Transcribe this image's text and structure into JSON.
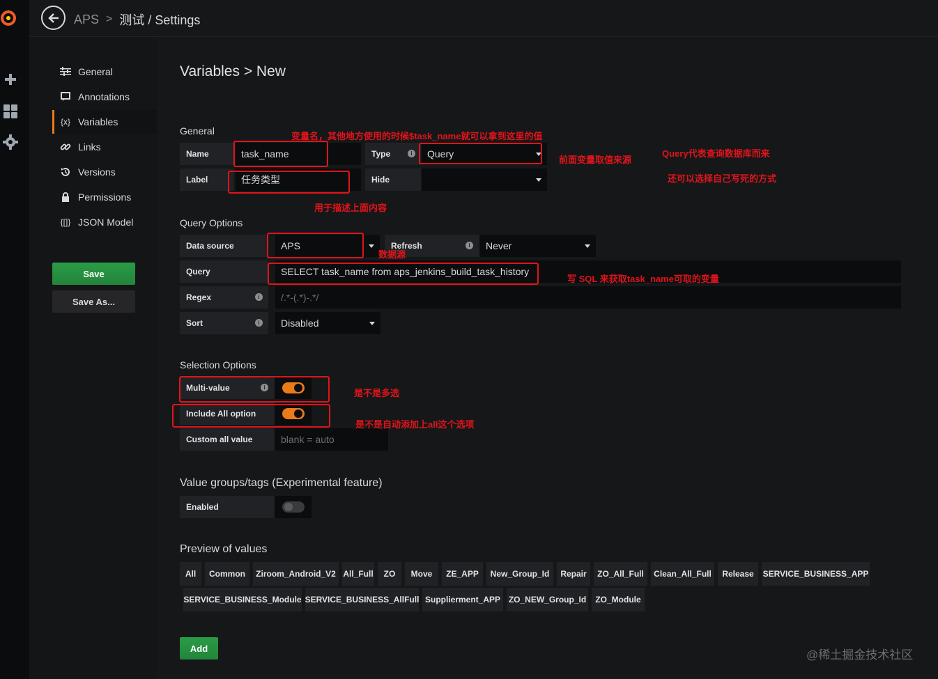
{
  "breadcrumb": {
    "app": "APS",
    "separator": ">",
    "page": "测试 / Settings"
  },
  "sidenav": {
    "items": [
      {
        "label": "General",
        "icon": "sliders-icon"
      },
      {
        "label": "Annotations",
        "icon": "comment-icon"
      },
      {
        "label": "Variables",
        "icon": "variable-icon"
      },
      {
        "label": "Links",
        "icon": "link-icon"
      },
      {
        "label": "Versions",
        "icon": "history-icon"
      },
      {
        "label": "Permissions",
        "icon": "lock-icon"
      },
      {
        "label": "JSON Model",
        "icon": "json-icon"
      }
    ],
    "active": "Variables",
    "save_label": "Save",
    "save_as_label": "Save As..."
  },
  "page_title": "Variables > New",
  "general": {
    "heading": "General",
    "name_label": "Name",
    "name_value": "task_name",
    "type_label": "Type",
    "type_value": "Query",
    "label_label": "Label",
    "label_value": "任务类型",
    "hide_label": "Hide",
    "hide_value": ""
  },
  "query_options": {
    "heading": "Query Options",
    "datasource_label": "Data source",
    "datasource_value": "APS",
    "refresh_label": "Refresh",
    "refresh_value": "Never",
    "query_label": "Query",
    "query_value": "SELECT task_name from aps_jenkins_build_task_history",
    "regex_label": "Regex",
    "regex_placeholder": "/.*-(.*)-.*/",
    "sort_label": "Sort",
    "sort_value": "Disabled"
  },
  "selection_options": {
    "heading": "Selection Options",
    "multi_label": "Multi-value",
    "multi_on": true,
    "include_all_label": "Include All option",
    "include_all_on": true,
    "custom_all_label": "Custom all value",
    "custom_all_placeholder": "blank = auto"
  },
  "value_groups": {
    "heading": "Value groups/tags (Experimental feature)",
    "enabled_label": "Enabled",
    "enabled_on": false
  },
  "preview": {
    "heading": "Preview of values",
    "row1": [
      "All",
      "Common",
      "Ziroom_Android_V2",
      "All_Full",
      "ZO",
      "Move",
      "ZE_APP",
      "New_Group_Id",
      "Repair",
      "ZO_All_Full",
      "Clean_All_Full",
      "Release",
      "SERVICE_BUSINESS_APP"
    ],
    "row2": [
      "SERVICE_BUSINESS_Module",
      "SERVICE_BUSINESS_AllFull",
      "Supplierment_APP",
      "ZO_NEW_Group_Id",
      "ZO_Module"
    ]
  },
  "add_label": "Add",
  "annotations": {
    "name_note": "变量名，其他地方使用的时候$task_name就可以拿到这里的值",
    "type_note": "前面变量取值来源",
    "query_type_note": "Query代表查询数据库而来",
    "other_note": "还可以选择自己写死的方式",
    "label_note": "用于描述上面内容",
    "datasource_note": "数据源",
    "sql_note": "写 SQL 来获取task_name可取的变量",
    "multi_note": "是不是多选",
    "include_all_note": "是不是自动添加上all这个选项"
  },
  "watermark": "@稀土掘金技术社区",
  "colors": {
    "accent": "#eb7b18",
    "save_green": "#299c46",
    "annotation_red": "#e0141b"
  }
}
